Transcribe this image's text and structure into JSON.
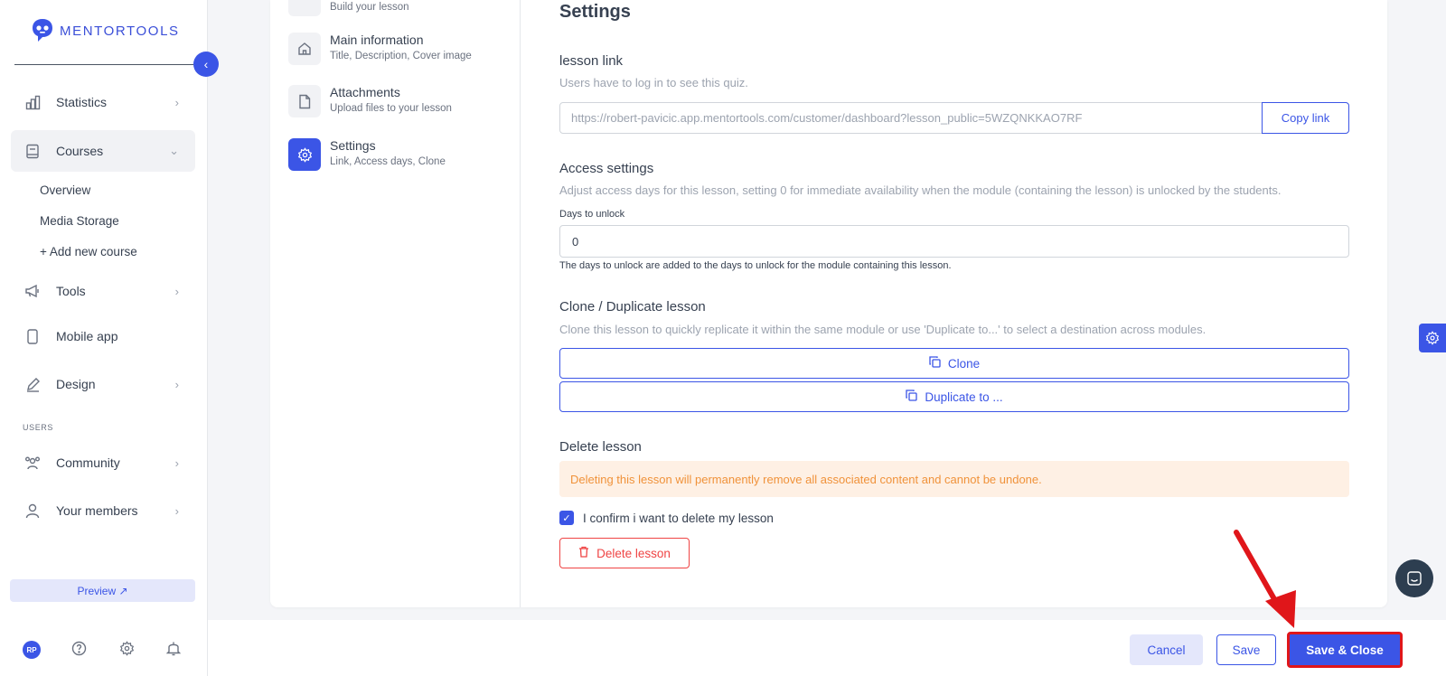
{
  "app": {
    "logo_text": "MENTORTOOLS",
    "brand_color": "#3b55e6",
    "annotation_color": "#e0161a"
  },
  "sidebar": {
    "items": [
      {
        "label": "Statistics",
        "icon": "bar-chart-icon",
        "has_chevron": true
      },
      {
        "label": "Courses",
        "icon": "book-icon",
        "active": true,
        "expanded": true
      },
      {
        "label": "Tools",
        "icon": "megaphone-icon",
        "has_chevron": true
      },
      {
        "label": "Mobile app",
        "icon": "phone-icon"
      },
      {
        "label": "Design",
        "icon": "pencil-icon",
        "has_chevron": true
      },
      {
        "label": "Community",
        "icon": "people-icon",
        "has_chevron": true
      },
      {
        "label": "Your members",
        "icon": "user-icon",
        "has_chevron": true
      }
    ],
    "course_subitems": [
      "Overview",
      "Media Storage",
      "+ Add new course"
    ],
    "users_section_label": "USERS",
    "preview_label": "Preview ↗",
    "avatar_initials": "RP"
  },
  "steps": [
    {
      "title": "",
      "subtitle": "Build your lesson"
    },
    {
      "title": "Main information",
      "subtitle": "Title, Description, Cover image",
      "icon": "home-icon"
    },
    {
      "title": "Attachments",
      "subtitle": "Upload files to your lesson",
      "icon": "file-icon"
    },
    {
      "title": "Settings",
      "subtitle": "Link, Access days, Clone",
      "icon": "gear-icon",
      "active": true
    }
  ],
  "settings": {
    "title": "Settings",
    "lesson_link": {
      "title": "lesson link",
      "description": "Users have to log in to see this quiz.",
      "url": "https://robert-pavicic.app.mentortools.com/customer/dashboard?lesson_public=5WZQNKKAO7RF",
      "copy_label": "Copy link"
    },
    "access": {
      "title": "Access settings",
      "description": "Adjust access days for this lesson, setting 0 for immediate availability when the module (containing the lesson) is unlocked by the students.",
      "days_label": "Days to unlock",
      "days_value": "0",
      "help": "The days to unlock are added to the days to unlock for the module containing this lesson."
    },
    "clone": {
      "title": "Clone / Duplicate lesson",
      "description": "Clone this lesson to quickly replicate it within the same module or use 'Duplicate to...' to select a destination across modules.",
      "clone_label": "Clone",
      "duplicate_label": "Duplicate to ..."
    },
    "delete": {
      "title": "Delete lesson",
      "warning": "Deleting this lesson will permanently remove all associated content and cannot be undone.",
      "confirm_label": "I confirm i want to delete my lesson",
      "confirm_checked": true,
      "delete_label": "Delete lesson"
    }
  },
  "footer": {
    "cancel_label": "Cancel",
    "save_label": "Save",
    "save_close_label": "Save & Close"
  }
}
